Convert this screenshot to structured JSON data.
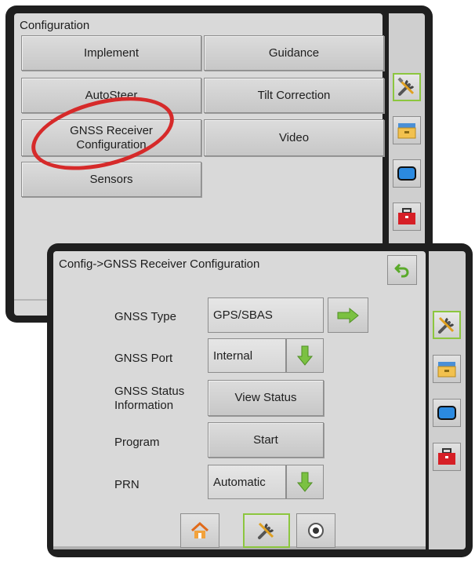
{
  "config_window": {
    "title": "Configuration",
    "buttons": {
      "implement": "Implement",
      "guidance": "Guidance",
      "autosteer": "AutoSteer",
      "tilt_correction": "Tilt Correction",
      "gnss_line1": "GNSS Receiver",
      "gnss_line2": "Configuration",
      "video": "Video",
      "sensors": "Sensors"
    },
    "side_icons": [
      "tools-icon",
      "folder-icon",
      "screen-icon",
      "toolbox-icon"
    ],
    "highlight_color": "#d62a2a"
  },
  "gnss_window": {
    "title": "Config->GNSS Receiver Configuration",
    "rows": {
      "gnss_type_label": "GNSS Type",
      "gnss_type_value": "GPS/SBAS",
      "gnss_port_label": "GNSS Port",
      "gnss_port_value": "Internal",
      "status_label_line1": "GNSS Status",
      "status_label_line2": "Information",
      "status_button": "View Status",
      "program_label": "Program",
      "program_button": "Start",
      "prn_label": "PRN",
      "prn_value": "Automatic"
    },
    "side_icons": [
      "tools-icon",
      "folder-icon",
      "screen-icon",
      "toolbox-icon"
    ],
    "bottom_tabs": [
      "home-icon",
      "tools-icon",
      "gauge-icon"
    ],
    "accent_color": "#8cc63f"
  }
}
